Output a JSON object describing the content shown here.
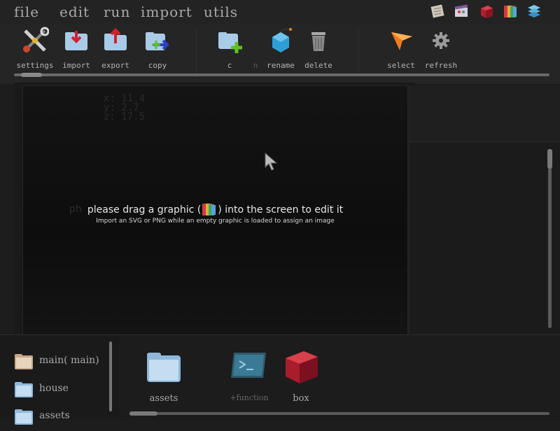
{
  "menu": {
    "file": "file",
    "edit": "edit",
    "run": "run",
    "import": "import",
    "utils": "utils"
  },
  "top_icons": [
    "notes-icon",
    "film-icon",
    "cube-icon",
    "graphic-icon",
    "stack-icon"
  ],
  "toolbar": {
    "settings": "settings",
    "import": "import",
    "export": "export",
    "copy": "copy",
    "new": "c",
    "n": "n",
    "rename": "rename",
    "delete": "delete",
    "select": "select",
    "refresh": "refresh"
  },
  "canvas": {
    "x_readout": "x: 11.4",
    "y_readout": "y: 2.7",
    "z_readout": "z: 17.5",
    "drag_before": "please drag a graphic (",
    "drag_after": ") into the screen to edit it",
    "drag_subtitle": "Import an SVG or PNG while an empty graphic is loaded to assign an image"
  },
  "folders": [
    {
      "label": "main( main)"
    },
    {
      "label": "house"
    },
    {
      "label": "assets"
    }
  ],
  "assets": {
    "assets": "assets",
    "function": "+function",
    "box": "box"
  },
  "colors": {
    "background": "#1d1d1d",
    "accent_red": "#c0283a",
    "folder_blue": "#8fb8dc",
    "arrow_green": "#5fbf2a"
  }
}
